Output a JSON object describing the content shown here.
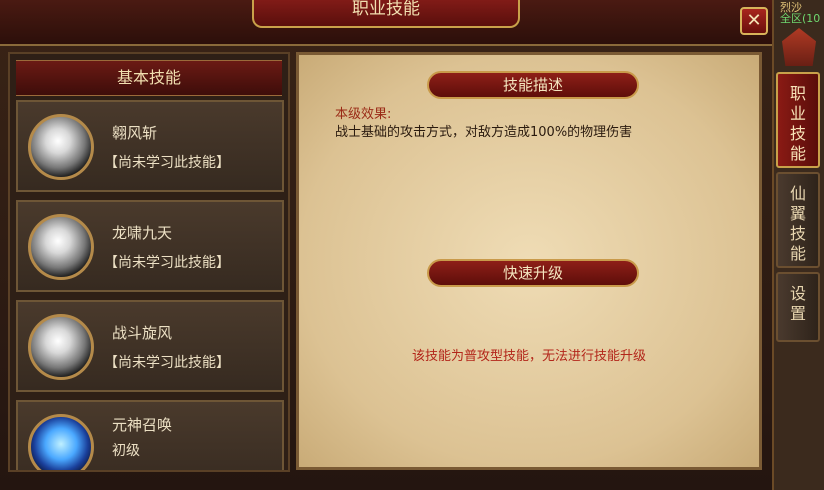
{
  "window": {
    "title": "职业技能",
    "close_label": "✕"
  },
  "skill_list": {
    "header": "基本技能",
    "skills": [
      {
        "name": "翱风斩",
        "status": "【尚未学习此技能】",
        "icon": "wind-slash-icon"
      },
      {
        "name": "龙啸九天",
        "status": "【尚未学习此技能】",
        "icon": "dragon-roar-icon"
      },
      {
        "name": "战斗旋风",
        "status": "【尚未学习此技能】",
        "icon": "whirlwind-icon"
      },
      {
        "name": "元神召唤",
        "status": "初级",
        "icon": "spirit-summon-icon"
      }
    ]
  },
  "description": {
    "header": "技能描述",
    "effect_label": "本级效果:",
    "effect_text": "战士基础的攻击方式，对敌方造成100%的物理伤害"
  },
  "upgrade": {
    "header": "快速升级",
    "message": "该技能为普攻型技能，无法进行技能升级"
  },
  "side": {
    "zone_title": "烈沙",
    "zone_sub": "全区(10",
    "tabs": [
      {
        "label": "职\n业\n技\n能",
        "active": true
      },
      {
        "label": "仙\n翼\n技\n能",
        "active": false
      },
      {
        "label": "设\n置",
        "active": false
      }
    ]
  }
}
